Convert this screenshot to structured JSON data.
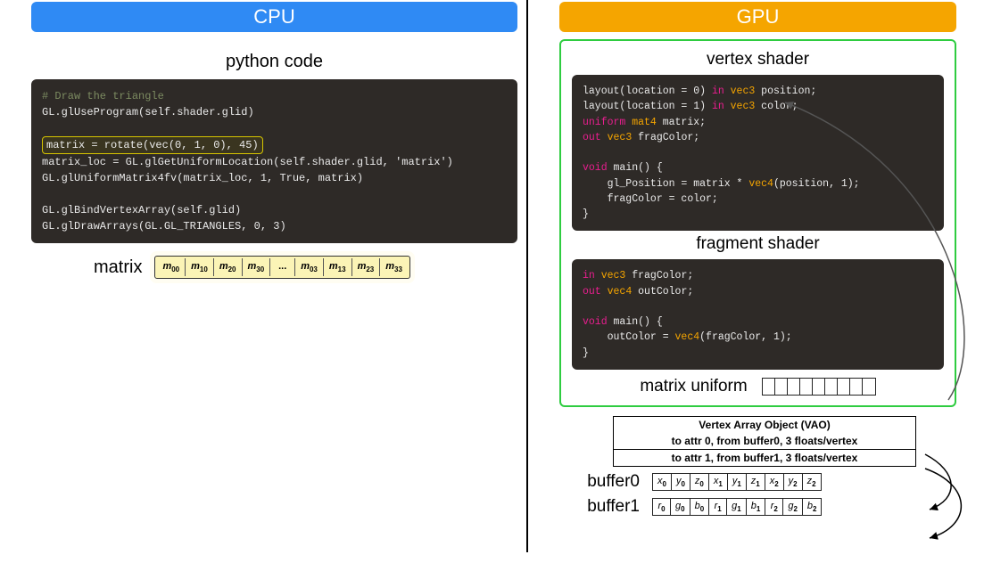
{
  "cpu": {
    "header": "CPU",
    "section_title": "python code",
    "code": {
      "comment": "# Draw the triangle",
      "l1": "GL.glUseProgram(self.shader.glid)",
      "l_hl": "matrix = rotate(vec(0, 1, 0), 45)",
      "l3": "matrix_loc = GL.glGetUniformLocation(self.shader.glid, 'matrix')",
      "l4": "GL.glUniformMatrix4fv(matrix_loc, 1, True, matrix)",
      "l5": "GL.glBindVertexArray(self.glid)",
      "l6": "GL.glDrawArrays(GL.GL_TRIANGLES, 0, 3)"
    },
    "matrix": {
      "label": "matrix",
      "cells": [
        "m00",
        "m10",
        "m20",
        "m30",
        "...",
        "m03",
        "m13",
        "m23",
        "m33"
      ]
    }
  },
  "gpu": {
    "header": "GPU",
    "vertex_title": "vertex shader",
    "fragment_title": "fragment shader",
    "vertex_code": [
      {
        "t": "plain",
        "s": "layout(location = 0) "
      },
      {
        "t": "kw-in",
        "s": "in"
      },
      {
        "t": "plain",
        "s": " "
      },
      {
        "t": "kw-type",
        "s": "vec3"
      },
      {
        "t": "plain",
        "s": " position;\n"
      },
      {
        "t": "plain",
        "s": "layout(location = 1) "
      },
      {
        "t": "kw-in",
        "s": "in"
      },
      {
        "t": "plain",
        "s": " "
      },
      {
        "t": "kw-type",
        "s": "vec3"
      },
      {
        "t": "plain",
        "s": " color;\n"
      },
      {
        "t": "kw-uniform",
        "s": "uniform"
      },
      {
        "t": "plain",
        "s": " "
      },
      {
        "t": "kw-type",
        "s": "mat4"
      },
      {
        "t": "plain",
        "s": " matrix;\n"
      },
      {
        "t": "kw-out",
        "s": "out"
      },
      {
        "t": "plain",
        "s": " "
      },
      {
        "t": "kw-type",
        "s": "vec3"
      },
      {
        "t": "plain",
        "s": " fragColor;\n\n"
      },
      {
        "t": "kw-void",
        "s": "void"
      },
      {
        "t": "plain",
        "s": " main() {\n    gl_Position = matrix * "
      },
      {
        "t": "kw-func",
        "s": "vec4"
      },
      {
        "t": "plain",
        "s": "(position, 1);\n    fragColor = color;\n}"
      }
    ],
    "fragment_code": [
      {
        "t": "kw-in",
        "s": "in"
      },
      {
        "t": "plain",
        "s": " "
      },
      {
        "t": "kw-type",
        "s": "vec3"
      },
      {
        "t": "plain",
        "s": " fragColor;\n"
      },
      {
        "t": "kw-out",
        "s": "out"
      },
      {
        "t": "plain",
        "s": " "
      },
      {
        "t": "kw-type",
        "s": "vec4"
      },
      {
        "t": "plain",
        "s": " outColor;\n\n"
      },
      {
        "t": "kw-void",
        "s": "void"
      },
      {
        "t": "plain",
        "s": " main() {\n    outColor = "
      },
      {
        "t": "kw-func",
        "s": "vec4"
      },
      {
        "t": "plain",
        "s": "(fragColor, 1);\n}"
      }
    ],
    "uniform_label": "matrix uniform",
    "uniform_cells": 9,
    "vao": {
      "title": "Vertex Array Object (VAO)",
      "row0": "to attr 0, from buffer0, 3 floats/vertex",
      "row1": "to attr 1, from buffer1, 3 floats/vertex"
    },
    "buffer0": {
      "label": "buffer0",
      "cells": [
        "x0",
        "y0",
        "z0",
        "x1",
        "y1",
        "z1",
        "x2",
        "y2",
        "z2"
      ]
    },
    "buffer1": {
      "label": "buffer1",
      "cells": [
        "r0",
        "g0",
        "b0",
        "r1",
        "g1",
        "b1",
        "r2",
        "g2",
        "b2"
      ]
    }
  }
}
